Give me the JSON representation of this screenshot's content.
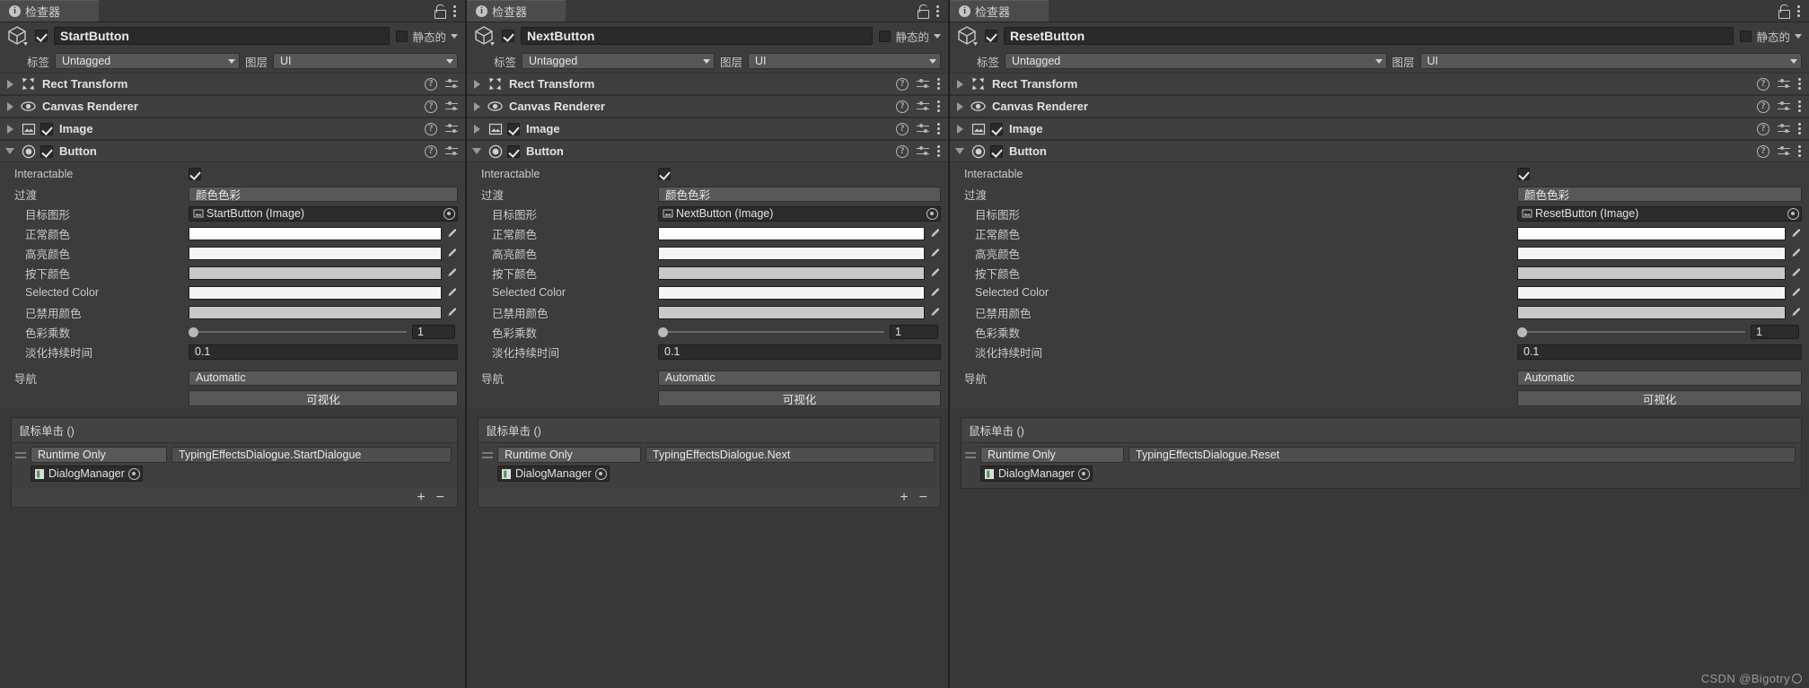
{
  "watermark": "CSDN @Bigotry",
  "common": {
    "tab_title": "检查器",
    "static_label": "静态的",
    "tag_label": "标签",
    "tag_value": "Untagged",
    "layer_label": "图层",
    "layer_value": "UI",
    "components": {
      "rect_transform": "Rect Transform",
      "canvas_renderer": "Canvas Renderer",
      "image": "Image",
      "button": "Button"
    },
    "button_props": {
      "interactable": "Interactable",
      "transition": "过渡",
      "transition_value": "颜色色彩",
      "target_graphic": "目标图形",
      "normal_color": "正常颜色",
      "highlighted_color": "高亮颜色",
      "pressed_color": "按下颜色",
      "selected_color": "Selected Color",
      "disabled_color": "已禁用颜色",
      "color_multiplier": "色彩乘数",
      "color_multiplier_value": "1",
      "fade_duration": "淡化持续时间",
      "fade_duration_value": "0.1",
      "navigation": "导航",
      "navigation_value": "Automatic",
      "visualize": "可视化"
    },
    "colors": {
      "normal": "#ffffff",
      "highlighted": "#f5f5f5",
      "pressed": "#c8c8c8",
      "selected": "#f5f5f5",
      "disabled": "#c8c8c8"
    },
    "event": {
      "title": "鼠标单击 ()",
      "callback_mode": "Runtime Only",
      "object_ref": "DialogManager",
      "add_label": "+",
      "remove_label": "−"
    }
  },
  "panels": [
    {
      "object_name": "StartButton",
      "target_graphic_value": "StartButton (Image)",
      "event_function": "TypingEffectsDialogue.StartDialogue"
    },
    {
      "object_name": "NextButton",
      "target_graphic_value": "NextButton (Image)",
      "event_function": "TypingEffectsDialogue.Next"
    },
    {
      "object_name": "ResetButton",
      "target_graphic_value": "ResetButton (Image)",
      "event_function": "TypingEffectsDialogue.Reset"
    }
  ]
}
